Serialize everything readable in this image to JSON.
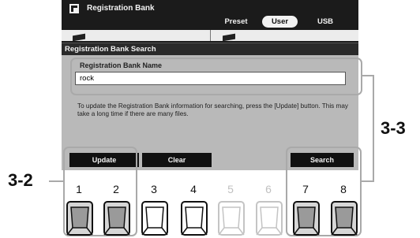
{
  "app": {
    "title": "Registration Bank"
  },
  "tabs": [
    {
      "label": "Preset",
      "selected": false
    },
    {
      "label": "User",
      "selected": true
    },
    {
      "label": "USB",
      "selected": false
    }
  ],
  "dialog": {
    "title": "Registration Bank Search",
    "name_label": "Registration Bank Name",
    "name_value": "rock",
    "info": "To update the Registration Bank information for searching, press the [Update] button. This may take a long time if there are many files."
  },
  "buttons": {
    "update": "Update",
    "clear": "Clear",
    "search": "Search"
  },
  "callouts": {
    "left": "3-2",
    "right": "3-3"
  },
  "panel_buttons": [
    {
      "number": "1",
      "active": true
    },
    {
      "number": "2",
      "active": true
    },
    {
      "number": "3",
      "active": true
    },
    {
      "number": "4",
      "active": true
    },
    {
      "number": "5",
      "active": false
    },
    {
      "number": "6",
      "active": false
    },
    {
      "number": "7",
      "active": true
    },
    {
      "number": "8",
      "active": true
    }
  ],
  "colors": {
    "highlight": "#a9a9a9",
    "screen_bg": "#1b1b1b",
    "dialog_bg": "#b9b9b9"
  }
}
